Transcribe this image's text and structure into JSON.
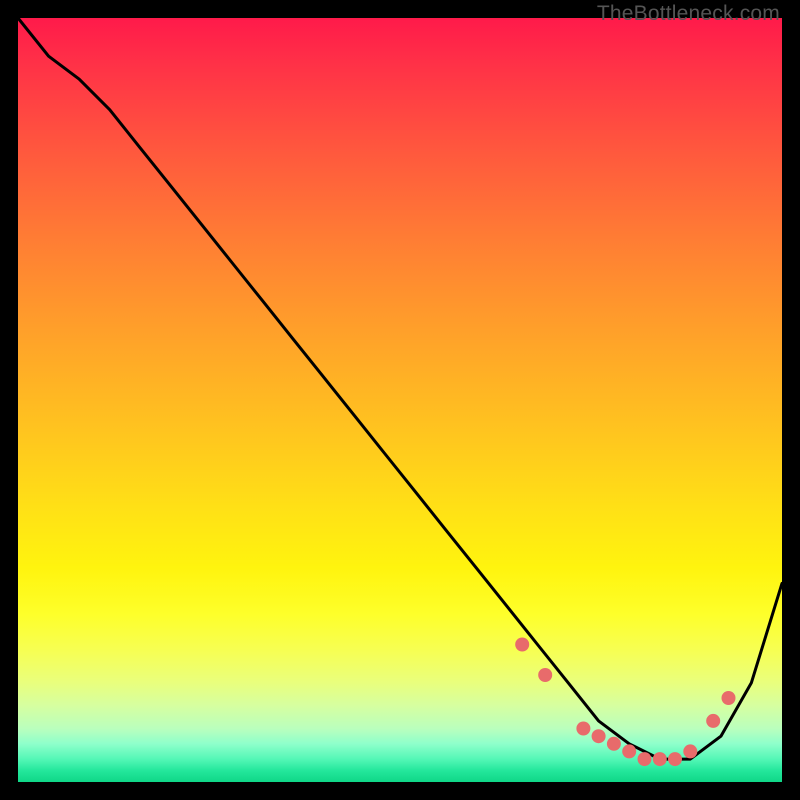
{
  "watermark": "TheBottleneck.com",
  "chart_data": {
    "type": "line",
    "title": "",
    "xlabel": "",
    "ylabel": "",
    "xlim": [
      0,
      100
    ],
    "ylim": [
      0,
      100
    ],
    "series": [
      {
        "name": "curve",
        "x": [
          0,
          4,
          8,
          12,
          16,
          20,
          24,
          28,
          32,
          36,
          40,
          44,
          48,
          52,
          56,
          60,
          64,
          68,
          72,
          76,
          80,
          84,
          88,
          92,
          96,
          100
        ],
        "y": [
          100,
          95,
          92,
          88,
          83,
          78,
          73,
          68,
          63,
          58,
          53,
          48,
          43,
          38,
          33,
          28,
          23,
          18,
          13,
          8,
          5,
          3,
          3,
          6,
          13,
          26
        ]
      }
    ],
    "markers": {
      "name": "dots",
      "color": "#e86b6b",
      "x": [
        66,
        69,
        74,
        76,
        78,
        80,
        82,
        84,
        86,
        88,
        91,
        93
      ],
      "y": [
        18,
        14,
        7,
        6,
        5,
        4,
        3,
        3,
        3,
        4,
        8,
        11
      ]
    }
  }
}
